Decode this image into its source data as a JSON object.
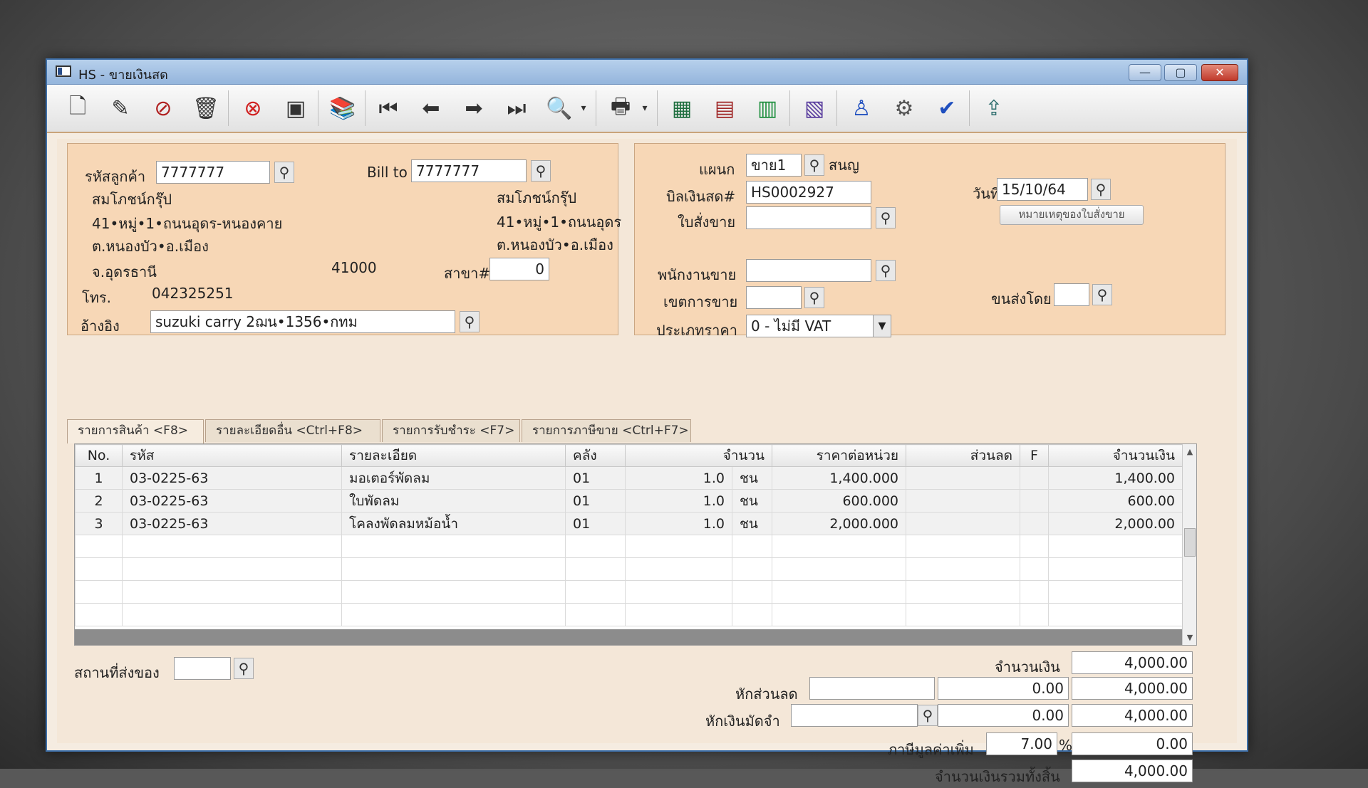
{
  "window": {
    "title": "HS - ขายเงินสด",
    "controls": {
      "minimize": "—",
      "maximize": "▢",
      "close": "✕"
    }
  },
  "toolbar": {
    "icons": [
      "new-document-icon",
      "edit-icon",
      "void-icon",
      "trash-icon",
      "cancel-icon",
      "save-icon",
      "book-icon",
      "first-record-icon",
      "previous-record-icon",
      "next-record-icon",
      "last-record-icon",
      "search-document-icon",
      "print-icon",
      "calculator-icon",
      "register-icon",
      "sales-order-icon",
      "report-icon",
      "approve-user-icon",
      "tools-icon",
      "confirm-icon",
      "export-icon"
    ]
  },
  "customer": {
    "code_label": "รหัสลูกค้า",
    "code": "7777777",
    "bill_to_label": "Bill to",
    "bill_to": "7777777",
    "name": "สมโภชน์กรุ๊ป",
    "address1": "41•หมู่•1•ถนนอุดร-หนองคาย",
    "address2": "ต.หนองบัว•อ.เมือง",
    "province": "จ.อุดรธานี",
    "postcode": "41000",
    "bill_name": "สมโภชน์กรุ๊ป",
    "bill_address1": "41•หมู่•1•ถนนอุดร",
    "bill_address2": "ต.หนองบัว•อ.เมือง",
    "branch_label": "สาขา#",
    "branch": "0",
    "phone_label": "โทร.",
    "phone": "042325251",
    "reference_label": "อ้างอิง",
    "reference": "suzuki carry 2ฌน•1356•กทม"
  },
  "document": {
    "department_label": "แผนก",
    "department": "ขาย1",
    "department_name": "สนญ",
    "bill_no_label": "บิลเงินสด#",
    "bill_no": "HS0002927",
    "date_label": "วันที่",
    "date": "15/10/64",
    "sales_order_label": "ใบสั่งขาย",
    "sales_order": "",
    "sales_order_note_button": "หมายเหตุของใบสั่งขาย",
    "salesperson_label": "พนักงานขาย",
    "salesperson": "",
    "sales_area_label": "เขตการขาย",
    "sales_area": "",
    "shipped_by_label": "ขนส่งโดย",
    "shipped_by": "",
    "price_type_label": "ประเภทราคา",
    "price_type": "0 - ไม่มี VAT"
  },
  "tabs": [
    {
      "label": "รายการสินค้า <F8>"
    },
    {
      "label": "รายละเอียดอื่น <Ctrl+F8>"
    },
    {
      "label": "รายการรับชำระ <F7>"
    },
    {
      "label": "รายการภาษีขาย <Ctrl+F7>"
    }
  ],
  "grid": {
    "headers": {
      "no": "No.",
      "code": "รหัส",
      "desc": "รายละเอียด",
      "warehouse": "คลัง",
      "qty": "จำนวน",
      "unit_price": "ราคาต่อหน่วย",
      "discount": "ส่วนลด",
      "flag": "F",
      "amount": "จำนวนเงิน"
    },
    "rows": [
      {
        "no": "1",
        "code": "03-0225-63",
        "desc": "มอเตอร์พัดลม",
        "warehouse": "01",
        "qty": "1.0",
        "unit": "ชน",
        "unit_price": "1,400.000",
        "discount": "",
        "flag": "",
        "amount": "1,400.00"
      },
      {
        "no": "2",
        "code": "03-0225-63",
        "desc": "ใบพัดลม",
        "warehouse": "01",
        "qty": "1.0",
        "unit": "ชน",
        "unit_price": "600.000",
        "discount": "",
        "flag": "",
        "amount": "600.00"
      },
      {
        "no": "3",
        "code": "03-0225-63",
        "desc": "โคลงพัดลมหม้อน้ำ",
        "warehouse": "01",
        "qty": "1.0",
        "unit": "ชน",
        "unit_price": "2,000.000",
        "discount": "",
        "flag": "",
        "amount": "2,000.00"
      }
    ]
  },
  "footer": {
    "ship_to_label": "สถานที่ส่งของ",
    "ship_to": "",
    "amount_label": "จำนวนเงิน",
    "amount": "4,000.00",
    "discount_label": "หักส่วนลด",
    "discount_text": "",
    "discount_value": "0.00",
    "after_discount": "4,000.00",
    "deposit_label": "หักเงินมัดจำ",
    "deposit_text": "",
    "deposit_value": "0.00",
    "after_deposit": "4,000.00",
    "vat_label": "ภาษีมูลค่าเพิ่ม",
    "vat_rate": "7.00",
    "vat_pct_sign": "%",
    "vat_amount": "0.00",
    "grand_total_label": "จำนวนเงินรวมทั้งสิ้น",
    "grand_total": "4,000.00"
  }
}
